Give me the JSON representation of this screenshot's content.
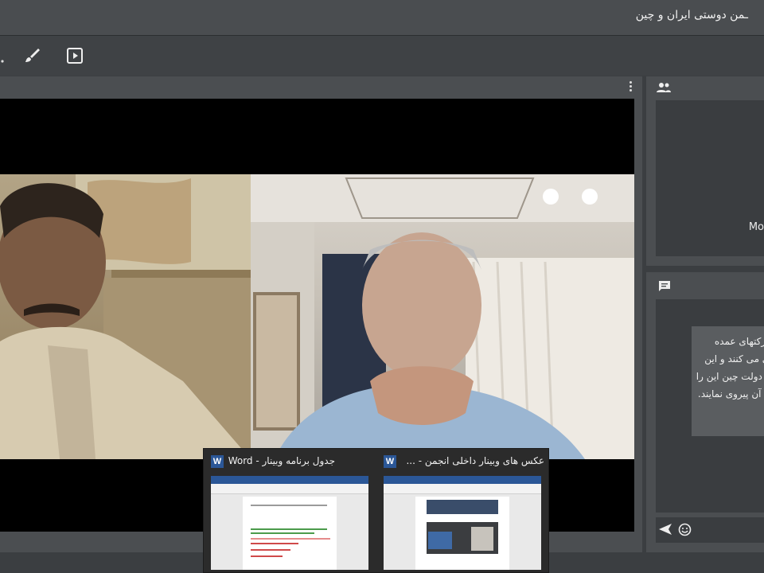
{
  "window": {
    "title": "ـمن دوستی ایران و چین"
  },
  "toolbar": {
    "icons": [
      "more-icon",
      "brush-icon",
      "presentation-icon"
    ]
  },
  "main_panel": {
    "menu_icon": "kebab-menu-icon"
  },
  "participants": {
    "icon": "people-icon",
    "moderator_label": "Mo"
  },
  "chat": {
    "icon": "chat-icon",
    "message_lines": [
      "شرکتهای عمده",
      "وی می کنند و این",
      "ت دولت چین این را",
      "ای آن پیروی نمایند."
    ],
    "send_icon": "send-icon",
    "emoji_icon": "emoji-icon"
  },
  "taskbar_preview": {
    "items": [
      {
        "title": "جدول برنامه وبینار - Word",
        "app_badge": "W"
      },
      {
        "title": "عکس های وبینار داخلی انجمن - ...",
        "app_badge": "W"
      }
    ]
  },
  "colors": {
    "topbar": "#4a4d50",
    "panel": "#4b4e51",
    "video_bg": "#000000",
    "word_blue": "#2b5797"
  }
}
